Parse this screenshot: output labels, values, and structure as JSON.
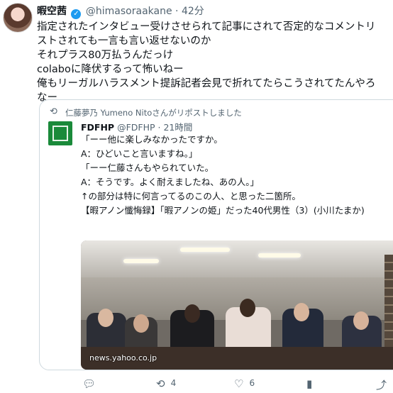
{
  "tweet": {
    "display_name": "暇空茜",
    "handle": "@himasoraakane",
    "separator": "·",
    "time": "42分",
    "lines": [
      "指定されたインタビュー受けさせられて記事にされて否定的なコメントリ",
      "ストされても一言も言い返せないのか",
      "それプラス80万払うんだっけ",
      "colaboに降伏するって怖いねー",
      "俺もリーガルハラスメント提訴記者会見で折れてたらこうされてたんやろ",
      "なー"
    ]
  },
  "quote": {
    "repost_text": "仁藤夢乃  Yumeno Nitoさんがリポストしました",
    "display_name": "FDFHP",
    "handle": "@FDFHP",
    "separator": "·",
    "time": "21時間",
    "text_lines": [
      "「ーー他に楽しみなかったですか。",
      "",
      "A：ひどいこと言いますね。」",
      "「ーー仁藤さんもやられていた。",
      "",
      "A：そうです。よく耐えましたね、あの人。」",
      "",
      "↑の部分は特に何言ってるのこの人、と思った二箇所。",
      "",
      "【暇アノン懺悔録】「暇アノンの姫」だった40代男性（3）(小川たまか)"
    ],
    "photo_watermark": "news.yahoo.co.jp"
  },
  "actions": {
    "reply_count": "",
    "retweet_count": "4",
    "like_count": "6"
  },
  "colors": {
    "verified": "#1d9bf0",
    "muted": "#536471",
    "fdfhp_green": "#1a8a3a"
  }
}
